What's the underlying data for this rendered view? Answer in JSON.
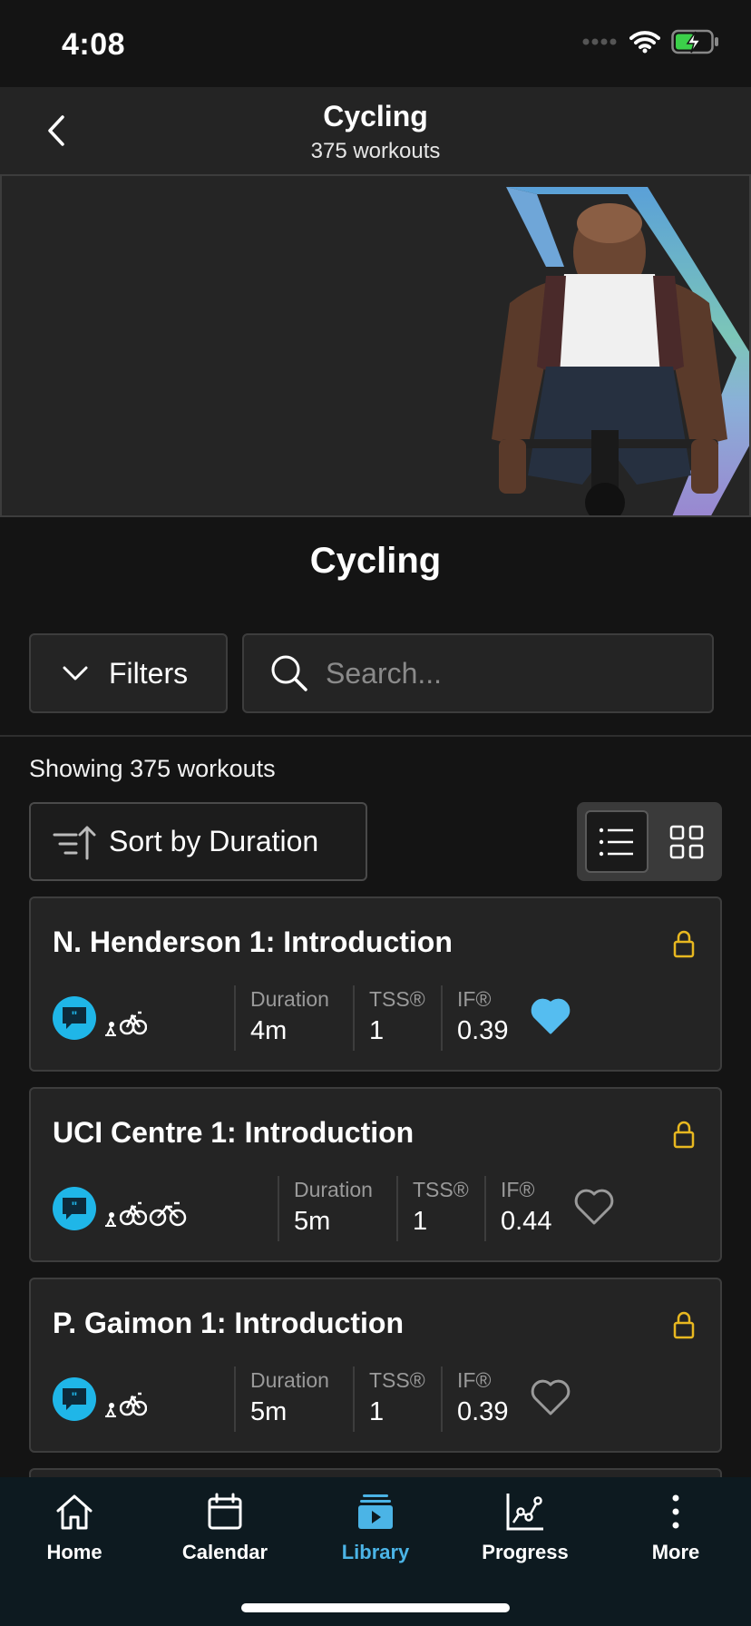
{
  "status_bar": {
    "time": "4:08"
  },
  "header": {
    "title": "Cycling",
    "subtitle": "375 workouts"
  },
  "section_title": "Cycling",
  "filters": {
    "label": "Filters"
  },
  "search": {
    "placeholder": "Search..."
  },
  "results": {
    "showing_text": "Showing 375 workouts"
  },
  "sort": {
    "label": "Sort by Duration"
  },
  "view_mode": "list",
  "workouts": [
    {
      "title": "N. Henderson 1: Introduction",
      "bikes": [
        "indoor-bike",
        "outdoor-bike"
      ],
      "duration_label": "Duration",
      "duration": "4m",
      "tss_label": "TSS®",
      "tss": "1",
      "if_label": "IF®",
      "if": "0.39",
      "favorite": true
    },
    {
      "title": "UCI Centre 1: Introduction",
      "bikes": [
        "indoor-bike",
        "outdoor-bike",
        "road-bike"
      ],
      "duration_label": "Duration",
      "duration": "5m",
      "tss_label": "TSS®",
      "tss": "1",
      "if_label": "IF®",
      "if": "0.44",
      "favorite": false
    },
    {
      "title": "P. Gaimon 1: Introduction",
      "bikes": [
        "indoor-bike",
        "outdoor-bike"
      ],
      "duration_label": "Duration",
      "duration": "5m",
      "tss_label": "TSS®",
      "tss": "1",
      "if_label": "IF®",
      "if": "0.39",
      "favorite": false
    }
  ],
  "tabs": [
    {
      "label": "Home",
      "icon": "home-icon",
      "active": false
    },
    {
      "label": "Calendar",
      "icon": "calendar-icon",
      "active": false
    },
    {
      "label": "Library",
      "icon": "library-icon",
      "active": true
    },
    {
      "label": "Progress",
      "icon": "progress-icon",
      "active": false
    },
    {
      "label": "More",
      "icon": "more-icon",
      "active": false
    }
  ],
  "colors": {
    "background": "#141414",
    "card": "#242424",
    "accent": "#4bb4e6",
    "coach_badge": "#1fb6e8",
    "lock": "#e8b820",
    "favorite": "#55bdf0",
    "tab_bar": "#0d1a20"
  }
}
